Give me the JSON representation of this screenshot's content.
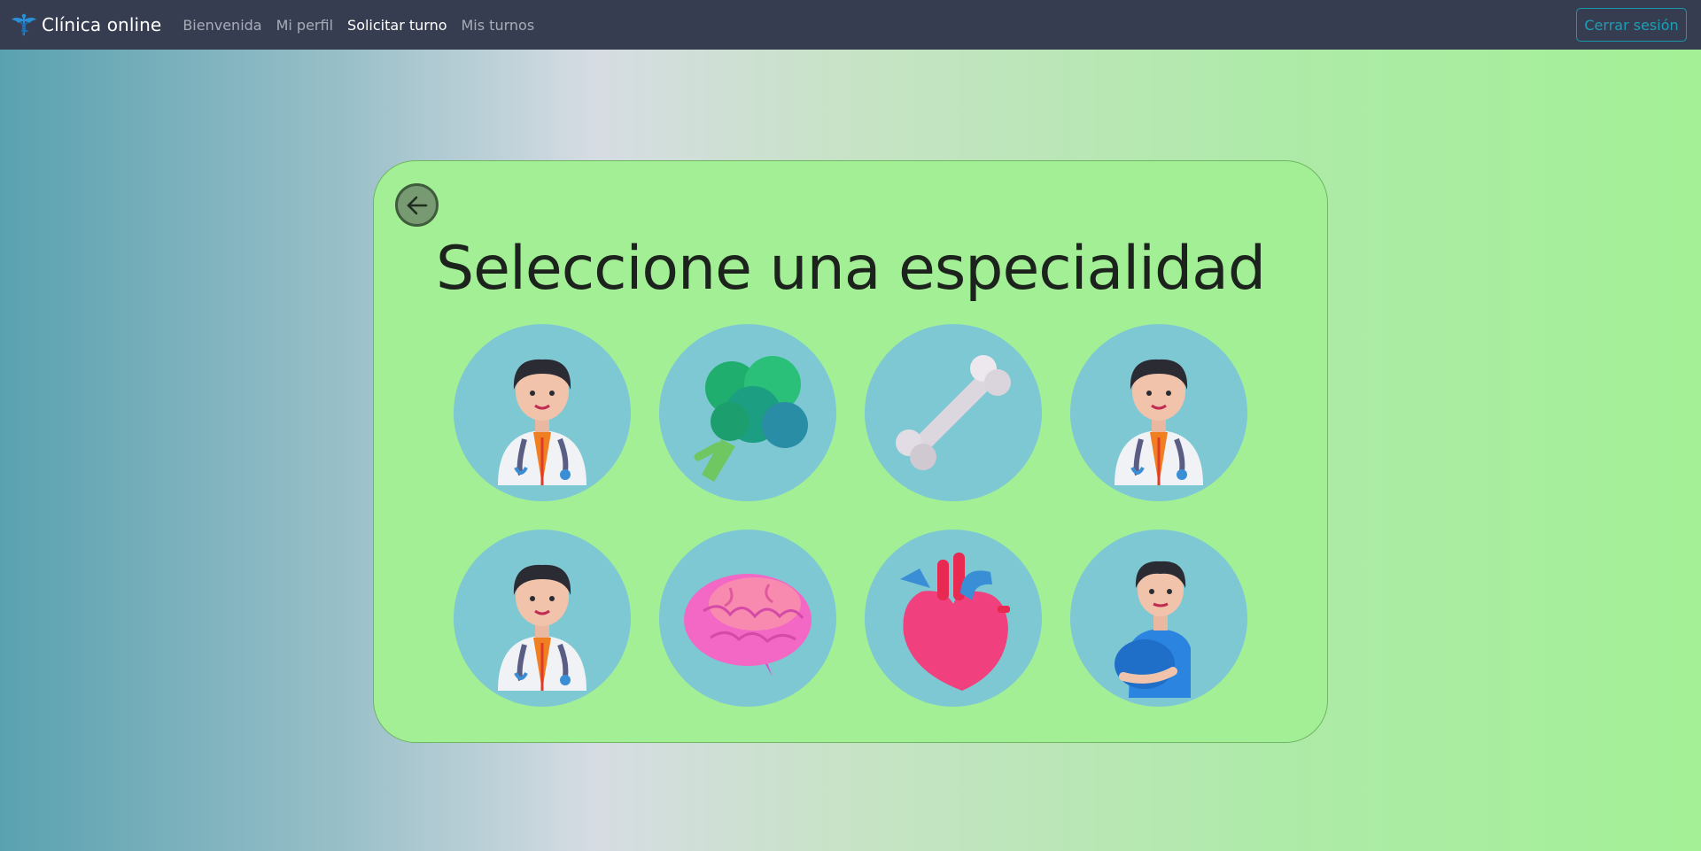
{
  "navbar": {
    "brand_icon": "caduceus-icon",
    "brand": "Clínica online",
    "links": [
      {
        "label": "Bienvenida",
        "active": false
      },
      {
        "label": "Mi perfil",
        "active": false
      },
      {
        "label": "Solicitar turno",
        "active": true
      },
      {
        "label": "Mis turnos",
        "active": false
      }
    ],
    "logout": "Cerrar sesión"
  },
  "card": {
    "back_icon": "arrow-left-icon",
    "title": "Seleccione una especialidad",
    "specialties": [
      {
        "icon": "doctor-icon"
      },
      {
        "icon": "broccoli-icon"
      },
      {
        "icon": "bone-icon"
      },
      {
        "icon": "doctor-icon"
      },
      {
        "icon": "doctor-icon"
      },
      {
        "icon": "brain-icon"
      },
      {
        "icon": "anatomical-heart-icon"
      },
      {
        "icon": "pregnant-man-icon"
      }
    ]
  },
  "colors": {
    "navbar": "#363d51",
    "card": "#a3ef96",
    "circle": "#7ec8d3",
    "logout": "#1c9fb6"
  }
}
